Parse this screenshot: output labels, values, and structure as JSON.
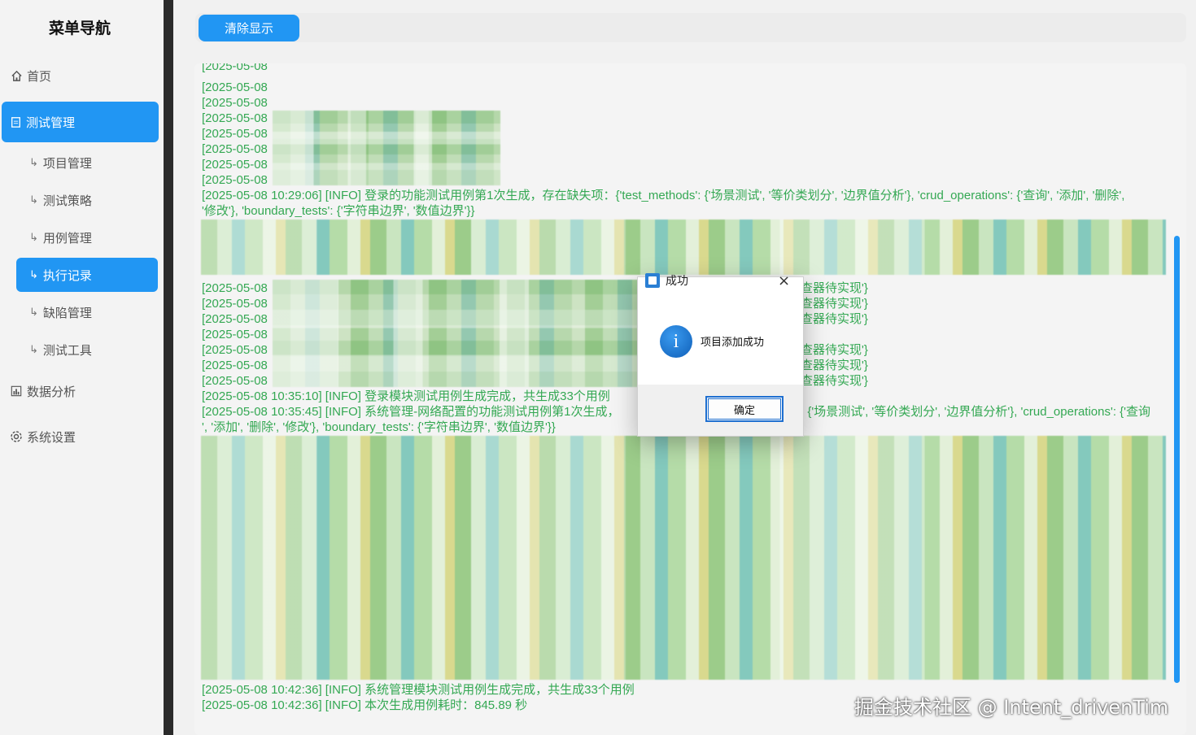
{
  "sidebar": {
    "title": "菜单导航",
    "items": [
      {
        "label": "首页"
      },
      {
        "label": "测试管理"
      },
      {
        "label": "数据分析"
      },
      {
        "label": "系统设置"
      }
    ],
    "sub_arrow": "↳",
    "sub_items": [
      {
        "label": "项目管理"
      },
      {
        "label": "测试策略"
      },
      {
        "label": "用例管理"
      },
      {
        "label": "执行记录"
      },
      {
        "label": "缺陷管理"
      },
      {
        "label": "测试工具"
      }
    ]
  },
  "toolbar": {
    "clear_label": "清除显示"
  },
  "log": {
    "ts_prefix": "[2025-05-08",
    "line_missing_1": "[2025-05-08 10:29:06] [INFO] 登录的功能测试用例第1次生成，存在缺失项：{'test_methods': {'场景测试', '等价类划分', '边界值分析'}, 'crud_operations': {'查询', '添加', '删除',",
    "line_missing_1b": "'修改'}, 'boundary_tests': {'字符串边界', '数值边界'}}",
    "frag_pending": "查器待实现'}",
    "line_login_done": "[2025-05-08 10:35:10] [INFO] 登录模块测试用例生成完成，共生成33个用例",
    "line_net_left": "[2025-05-08 10:35:45] [INFO] 系统管理-网络配置的功能测试用例第1次生成，",
    "line_net_right": ": {'场景测试', '等价类划分', '边界值分析'}, 'crud_operations': {'查询",
    "line_net_b": "', '添加', '删除', '修改'}, 'boundary_tests': {'字符串边界', '数值边界'}}",
    "line_sys_done": "[2025-05-08 10:42:36] [INFO] 系统管理模块测试用例生成完成，共生成33个用例",
    "line_elapsed": "[2025-05-08 10:42:36] [INFO] 本次生成用例耗时：845.89 秒"
  },
  "dialog": {
    "title": "成功",
    "close": "×",
    "message": "项目添加成功",
    "ok_label": "确定"
  },
  "watermark": "掘金技术社区 @ Intent_drivenTim",
  "colors": {
    "accent": "#2196f3",
    "log_text": "#34a853"
  }
}
